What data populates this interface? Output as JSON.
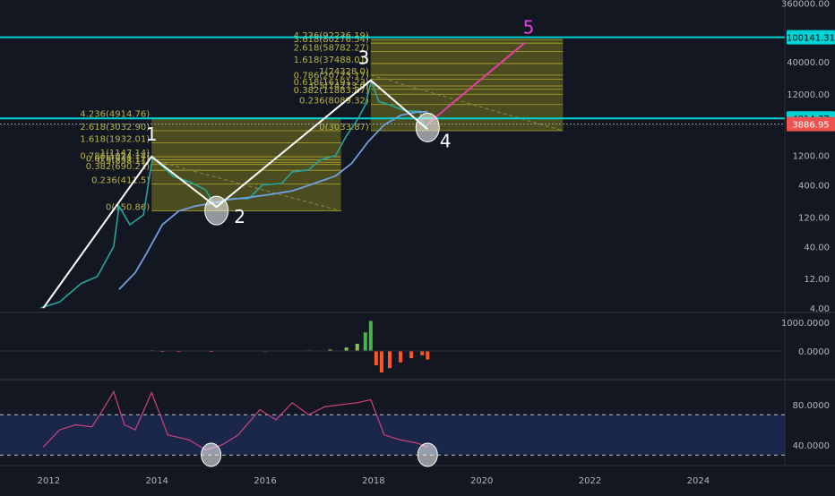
{
  "chart_data": {
    "type": "line",
    "title": "",
    "main_panel": {
      "scale": "log",
      "y_tick_labels": [
        "360000.00",
        "40000.00",
        "12000.00",
        "1200.00",
        "400.00",
        "120.00",
        "40.00",
        "12.00",
        "4.00"
      ],
      "price_labels": [
        {
          "label": "100141.31",
          "color": "#00d3d6"
        },
        {
          "label": "4814.37",
          "color": "#00d3d6"
        },
        {
          "label": "3886.95",
          "color": "#ef5350"
        }
      ],
      "horizontal_levels": [
        100141.31,
        4814.37
      ],
      "wave_labels": [
        {
          "label": "1",
          "year": 2013.9,
          "price": 1150
        },
        {
          "label": "2",
          "year": 2015.1,
          "price": 175
        },
        {
          "label": "3",
          "year": 2017.95,
          "price": 20000
        },
        {
          "label": "4",
          "year": 2019.0,
          "price": 3200
        },
        {
          "label": "5",
          "year": 2020.8,
          "price": 82000
        }
      ],
      "fib_boxes": [
        {
          "year_start": 2013.9,
          "year_end": 2017.4,
          "levels": [
            {
              "label": "4.236(4914.76)",
              "price": 4914.76
            },
            {
              "label": "2.618(3032.90)",
              "price": 3032.9
            },
            {
              "label": "1.618(1932.01)",
              "price": 1932.01
            },
            {
              "label": "1(1147.14)",
              "price": 1147.14
            },
            {
              "label": "0.786(1024.14)",
              "price": 1024.14
            },
            {
              "label": "0.618(931.12)",
              "price": 931.12
            },
            {
              "label": "0.5(858.11)",
              "price": 858.11
            },
            {
              "label": "0.382(690.21)",
              "price": 690.21
            },
            {
              "label": "0.236(411.5)",
              "price": 411.5
            },
            {
              "label": "0(150.86)",
              "price": 150.86
            }
          ]
        },
        {
          "year_start": 2017.95,
          "year_end": 2021.5,
          "levels": [
            {
              "label": "4.236(92236.19)",
              "price": 92236.19
            },
            {
              "label": "3.618(80276.54)",
              "price": 80276.54
            },
            {
              "label": "2.618(58782.27)",
              "price": 58782.27
            },
            {
              "label": "1.618(37488.01)",
              "price": 37488.01
            },
            {
              "label": "1(24328.0)",
              "price": 24328
            },
            {
              "label": "0.786(20723.17)",
              "price": 20723.17
            },
            {
              "label": "0.618(16191.23)",
              "price": 16191.23
            },
            {
              "label": "0.5(14273.0)",
              "price": 14273
            },
            {
              "label": "0.382(11883.87)",
              "price": 11883.87
            },
            {
              "label": "0.236(8089.32)",
              "price": 8089.32
            },
            {
              "label": "0(3033.87)",
              "price": 3033.87
            }
          ]
        }
      ],
      "price_series": [
        {
          "year": 2011.85,
          "price": 4
        },
        {
          "year": 2012.2,
          "price": 5
        },
        {
          "year": 2012.6,
          "price": 10
        },
        {
          "year": 2012.9,
          "price": 13
        },
        {
          "year": 2013.2,
          "price": 40
        },
        {
          "year": 2013.3,
          "price": 180
        },
        {
          "year": 2013.5,
          "price": 90
        },
        {
          "year": 2013.75,
          "price": 130
        },
        {
          "year": 2013.92,
          "price": 1150
        },
        {
          "year": 2014.1,
          "price": 800
        },
        {
          "year": 2014.3,
          "price": 550
        },
        {
          "year": 2014.6,
          "price": 450
        },
        {
          "year": 2014.9,
          "price": 330
        },
        {
          "year": 2015.05,
          "price": 200
        },
        {
          "year": 2015.4,
          "price": 240
        },
        {
          "year": 2015.7,
          "price": 240
        },
        {
          "year": 2015.95,
          "price": 400
        },
        {
          "year": 2016.3,
          "price": 420
        },
        {
          "year": 2016.5,
          "price": 650
        },
        {
          "year": 2016.8,
          "price": 700
        },
        {
          "year": 2017.0,
          "price": 1000
        },
        {
          "year": 2017.3,
          "price": 1200
        },
        {
          "year": 2017.5,
          "price": 2500
        },
        {
          "year": 2017.7,
          "price": 4500
        },
        {
          "year": 2017.85,
          "price": 8000
        },
        {
          "year": 2017.96,
          "price": 19500
        },
        {
          "year": 2018.1,
          "price": 9000
        },
        {
          "year": 2018.3,
          "price": 8000
        },
        {
          "year": 2018.6,
          "price": 6300
        },
        {
          "year": 2018.85,
          "price": 6300
        },
        {
          "year": 2018.95,
          "price": 3400
        },
        {
          "year": 2019.0,
          "price": 3900
        }
      ],
      "moving_average": [
        {
          "year": 2013.3,
          "price": 8
        },
        {
          "year": 2013.6,
          "price": 15
        },
        {
          "year": 2013.8,
          "price": 30
        },
        {
          "year": 2014.1,
          "price": 90
        },
        {
          "year": 2014.4,
          "price": 150
        },
        {
          "year": 2014.7,
          "price": 180
        },
        {
          "year": 2015.0,
          "price": 200
        },
        {
          "year": 2015.3,
          "price": 230
        },
        {
          "year": 2015.7,
          "price": 250
        },
        {
          "year": 2016.1,
          "price": 280
        },
        {
          "year": 2016.5,
          "price": 320
        },
        {
          "year": 2016.9,
          "price": 420
        },
        {
          "year": 2017.3,
          "price": 560
        },
        {
          "year": 2017.6,
          "price": 900
        },
        {
          "year": 2017.9,
          "price": 2000
        },
        {
          "year": 2018.2,
          "price": 3800
        },
        {
          "year": 2018.5,
          "price": 5400
        },
        {
          "year": 2018.8,
          "price": 6100
        },
        {
          "year": 2019.0,
          "price": 6200
        }
      ],
      "projection": [
        {
          "year": 2019.0,
          "price": 3900
        },
        {
          "year": 2020.8,
          "price": 82000
        }
      ]
    },
    "macd_panel": {
      "y_tick_labels": [
        "1000.0000",
        "0.0000"
      ],
      "bars": [
        {
          "year": 2013.9,
          "value": 20
        },
        {
          "year": 2014.1,
          "value": -15
        },
        {
          "year": 2014.4,
          "value": -10
        },
        {
          "year": 2015.0,
          "value": -5
        },
        {
          "year": 2016.0,
          "value": 10
        },
        {
          "year": 2016.8,
          "value": 20
        },
        {
          "year": 2017.2,
          "value": 50
        },
        {
          "year": 2017.5,
          "value": 120
        },
        {
          "year": 2017.7,
          "value": 250
        },
        {
          "year": 2017.85,
          "value": 650
        },
        {
          "year": 2017.95,
          "value": 1050
        },
        {
          "year": 2018.05,
          "value": -500
        },
        {
          "year": 2018.15,
          "value": -750
        },
        {
          "year": 2018.3,
          "value": -600
        },
        {
          "year": 2018.5,
          "value": -400
        },
        {
          "year": 2018.7,
          "value": -250
        },
        {
          "year": 2018.9,
          "value": -150
        },
        {
          "year": 2019.0,
          "value": -300
        }
      ]
    },
    "rsi_panel": {
      "y_tick_labels": [
        "80.0000",
        "40.0000"
      ],
      "band": [
        30,
        70
      ],
      "values": [
        {
          "year": 2011.9,
          "value": 38
        },
        {
          "year": 2012.2,
          "value": 55
        },
        {
          "year": 2012.5,
          "value": 60
        },
        {
          "year": 2012.8,
          "value": 58
        },
        {
          "year": 2013.0,
          "value": 75
        },
        {
          "year": 2013.2,
          "value": 93
        },
        {
          "year": 2013.4,
          "value": 60
        },
        {
          "year": 2013.6,
          "value": 55
        },
        {
          "year": 2013.9,
          "value": 92
        },
        {
          "year": 2014.2,
          "value": 50
        },
        {
          "year": 2014.6,
          "value": 45
        },
        {
          "year": 2014.9,
          "value": 35
        },
        {
          "year": 2015.2,
          "value": 40
        },
        {
          "year": 2015.5,
          "value": 50
        },
        {
          "year": 2015.9,
          "value": 75
        },
        {
          "year": 2016.2,
          "value": 65
        },
        {
          "year": 2016.5,
          "value": 82
        },
        {
          "year": 2016.8,
          "value": 70
        },
        {
          "year": 2017.1,
          "value": 78
        },
        {
          "year": 2017.4,
          "value": 80
        },
        {
          "year": 2017.7,
          "value": 82
        },
        {
          "year": 2017.95,
          "value": 85
        },
        {
          "year": 2018.2,
          "value": 50
        },
        {
          "year": 2018.5,
          "value": 45
        },
        {
          "year": 2018.8,
          "value": 42
        },
        {
          "year": 2019.0,
          "value": 38
        }
      ]
    },
    "x_axis": {
      "tick_labels": [
        "2012",
        "2014",
        "2016",
        "2018",
        "2020",
        "2022",
        "2024"
      ],
      "range": [
        2011.1,
        2025.6
      ]
    }
  }
}
